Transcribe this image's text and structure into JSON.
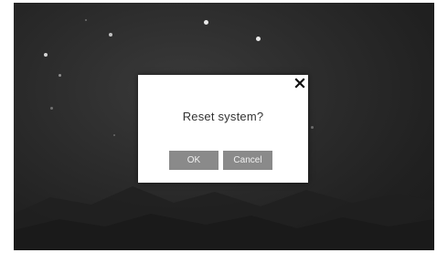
{
  "background": {
    "description_color": "#262626"
  },
  "dialog": {
    "message": "Reset system?",
    "ok_label": "OK",
    "cancel_label": "Cancel",
    "close_icon": "close-icon",
    "button_color": "#8a8a8a"
  }
}
